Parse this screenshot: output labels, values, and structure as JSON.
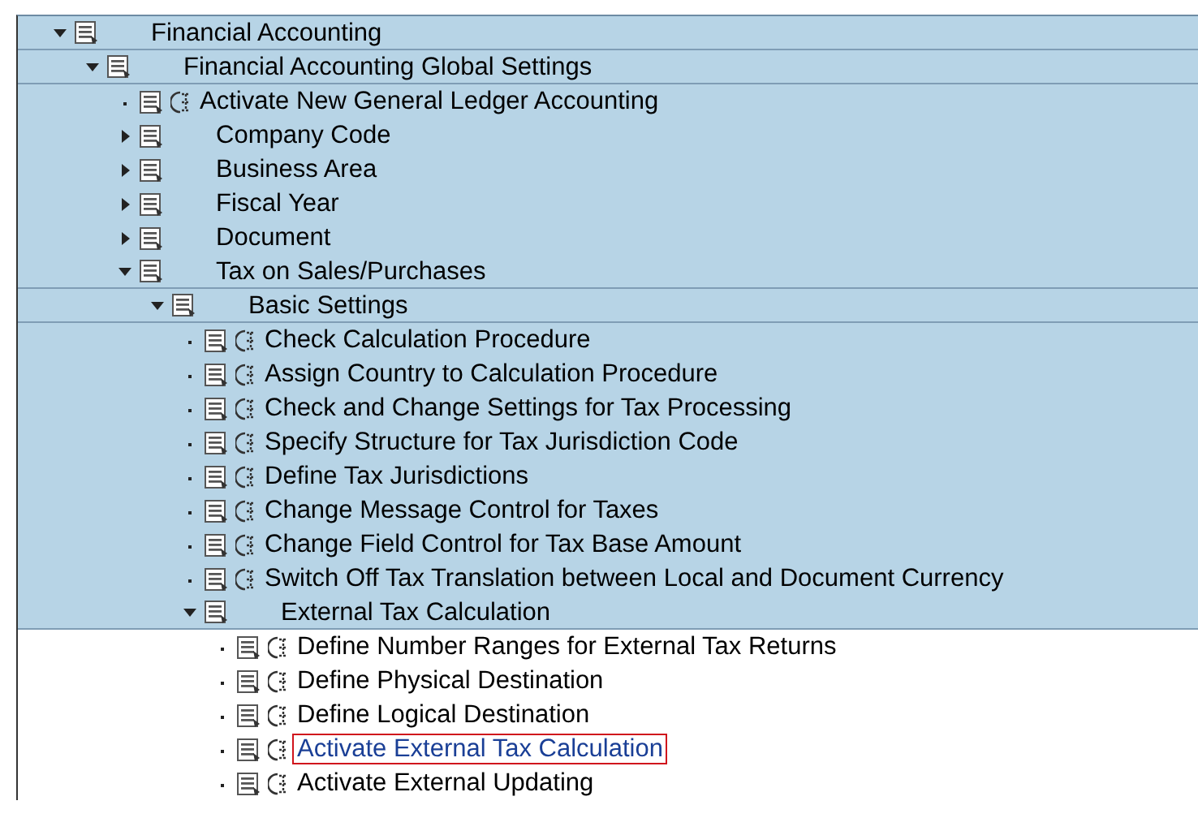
{
  "tree": [
    {
      "label": "Financial Accounting",
      "kind": "folder",
      "expanded": true,
      "shaded": true,
      "selected": false,
      "children": [
        {
          "label": "Financial Accounting Global Settings",
          "kind": "folder",
          "expanded": true,
          "shaded": true,
          "selected": false,
          "children": [
            {
              "label": "Activate New General Ledger Accounting",
              "kind": "activity",
              "shaded": true,
              "selected": false
            },
            {
              "label": "Company Code",
              "kind": "folder",
              "expanded": false,
              "shaded": true,
              "selected": false
            },
            {
              "label": "Business Area",
              "kind": "folder",
              "expanded": false,
              "shaded": true,
              "selected": false
            },
            {
              "label": "Fiscal Year",
              "kind": "folder",
              "expanded": false,
              "shaded": true,
              "selected": false
            },
            {
              "label": "Document",
              "kind": "folder",
              "expanded": false,
              "shaded": true,
              "selected": false
            },
            {
              "label": "Tax on Sales/Purchases",
              "kind": "folder",
              "expanded": true,
              "shaded": true,
              "selected": false,
              "children": [
                {
                  "label": "Basic Settings",
                  "kind": "folder",
                  "expanded": true,
                  "shaded": true,
                  "selected": false,
                  "children": [
                    {
                      "label": "Check Calculation Procedure",
                      "kind": "activity",
                      "shaded": true,
                      "selected": false
                    },
                    {
                      "label": "Assign Country to Calculation Procedure",
                      "kind": "activity",
                      "shaded": true,
                      "selected": false
                    },
                    {
                      "label": "Check and Change Settings for Tax Processing",
                      "kind": "activity",
                      "shaded": true,
                      "selected": false
                    },
                    {
                      "label": "Specify Structure for Tax Jurisdiction Code",
                      "kind": "activity",
                      "shaded": true,
                      "selected": false
                    },
                    {
                      "label": "Define Tax Jurisdictions",
                      "kind": "activity",
                      "shaded": true,
                      "selected": false
                    },
                    {
                      "label": "Change Message Control for Taxes",
                      "kind": "activity",
                      "shaded": true,
                      "selected": false
                    },
                    {
                      "label": "Change Field Control for Tax Base Amount",
                      "kind": "activity",
                      "shaded": true,
                      "selected": false
                    },
                    {
                      "label": "Switch Off Tax Translation between Local and Document Currency",
                      "kind": "activity",
                      "shaded": true,
                      "selected": false
                    },
                    {
                      "label": "External Tax Calculation",
                      "kind": "folder",
                      "expanded": true,
                      "shaded": true,
                      "selected": false,
                      "children": [
                        {
                          "label": "Define Number Ranges for External Tax Returns",
                          "kind": "activity",
                          "shaded": false,
                          "selected": false
                        },
                        {
                          "label": "Define Physical Destination",
                          "kind": "activity",
                          "shaded": false,
                          "selected": false
                        },
                        {
                          "label": "Define Logical Destination",
                          "kind": "activity",
                          "shaded": false,
                          "selected": false
                        },
                        {
                          "label": "Activate External Tax Calculation",
                          "kind": "activity",
                          "shaded": false,
                          "selected": true
                        },
                        {
                          "label": "Activate External Updating",
                          "kind": "activity",
                          "shaded": false,
                          "selected": false
                        }
                      ]
                    }
                  ]
                }
              ]
            }
          ]
        }
      ]
    }
  ]
}
